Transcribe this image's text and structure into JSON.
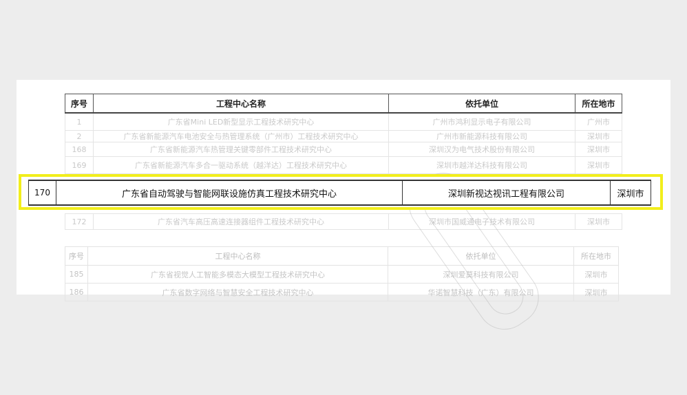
{
  "columns": {
    "no": "序号",
    "name": "工程中心名称",
    "unit": "依托单位",
    "city": "所在地市"
  },
  "top_rows": [
    {
      "no": "1",
      "name": "广东省Mini LED新型显示工程技术研究中心",
      "unit": "广州市鸿利显示电子有限公司",
      "city": "广州市"
    },
    {
      "no": "2",
      "name": "广东省新能源汽车电池安全与热管理系统（广州市）工程技术研究中心",
      "unit": "广州市新能源科技有限公司",
      "city": "深圳市"
    },
    {
      "no": "168",
      "name": "广东省新能源汽车热管理关键零部件工程技术研究中心",
      "unit": "深圳汉为电气技术股份有限公司",
      "city": "深圳市"
    },
    {
      "no": "169",
      "name": "广东省新能源汽车多合一驱动系统（越洋达）工程技术研究中心",
      "unit": "深圳市越洋达科技有限公司",
      "city": "深圳市"
    }
  ],
  "highlight": {
    "no": "170",
    "name": "广东省自动驾驶与智能网联设施仿真工程技术研究中心",
    "unit": "深圳新视达视讯工程有限公司",
    "city": "深圳市"
  },
  "after_row": {
    "no": "172",
    "name": "广东省汽车高压高速连接器组件工程技术研究中心",
    "unit": "深圳市国威通电子技术有限公司",
    "city": "深圳市"
  },
  "bottom_rows": [
    {
      "no": "185",
      "name": "广东省视觉人工智能多模态大模型工程技术研究中心",
      "unit": "深圳爱莫科技有限公司",
      "city": "深圳市"
    },
    {
      "no": "186",
      "name": "广东省数字网络与智慧安全工程技术研究中心",
      "unit": "华诺智慧科技（广东）有限公司",
      "city": "深圳市"
    }
  ]
}
